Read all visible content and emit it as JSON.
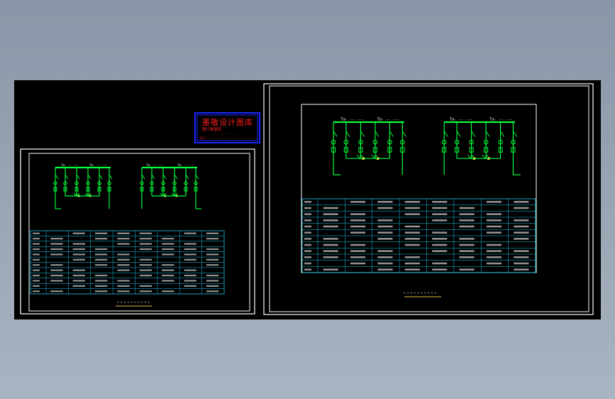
{
  "colors": {
    "background": "#8c99aa",
    "sheet": "#000000",
    "frame": "#ffffff",
    "bus": "#00ff3c",
    "table": "#18c8e6",
    "text": "#ffffff",
    "stamp_red": "#ff1e1e",
    "stamp_blue": "#1c28ff",
    "title_underline": "#e6c040"
  },
  "stamp": {
    "line1": "墨敬设计图库",
    "line2": "暂行数据库",
    "line3": "--- -- ----. --",
    "line4": "Tel: -- ----- ---- ---- -------"
  },
  "left_drawing": {
    "bus_labels": [
      "Ta- -- ---",
      "Ta- -- ---",
      "Ta- -- ---",
      "Ta- -- ---"
    ],
    "title": "----------"
  },
  "right_drawing": {
    "bus_labels": [
      "Ta- -- ---",
      "Ta- -- ---",
      "Ta- -- ---",
      "Ta- -- ---"
    ],
    "title": "----------"
  }
}
